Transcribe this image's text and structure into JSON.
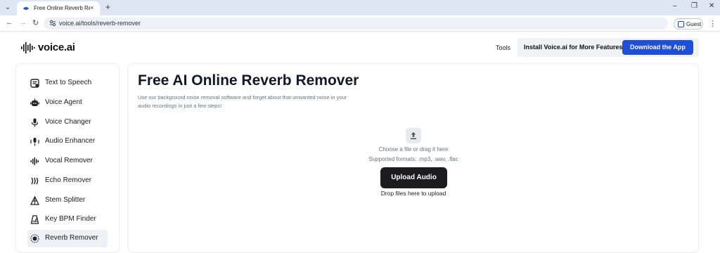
{
  "browser": {
    "tab_title": "Free Online Reverb Remover",
    "tab_close": "×",
    "new_tab": "+",
    "url": "voice.ai/tools/reverb-remover",
    "profile_label": "Guest",
    "window_controls": [
      "–",
      "❐",
      "✕"
    ],
    "nav": {
      "back": "←",
      "forward": "→",
      "reload": "↻"
    },
    "menu": "⋮"
  },
  "header": {
    "logo_text": "voice.ai",
    "tools_link": "Tools",
    "cta_text": "Install Voice.ai for More Features",
    "download_button": "Download the App"
  },
  "sidebar": {
    "items": [
      {
        "label": "Text to Speech",
        "icon": "text-to-speech-icon",
        "active": false
      },
      {
        "label": "Voice Agent",
        "icon": "voice-agent-icon",
        "active": false
      },
      {
        "label": "Voice Changer",
        "icon": "microphone-icon",
        "active": false
      },
      {
        "label": "Audio Enhancer",
        "icon": "audio-enhancer-icon",
        "active": false
      },
      {
        "label": "Vocal Remover",
        "icon": "waveform-icon",
        "active": false
      },
      {
        "label": "Echo Remover",
        "icon": "echo-icon",
        "active": false
      },
      {
        "label": "Stem Splitter",
        "icon": "stem-splitter-icon",
        "active": false
      },
      {
        "label": "Key BPM Finder",
        "icon": "metronome-icon",
        "active": false
      },
      {
        "label": "Reverb Remover",
        "icon": "reverb-icon",
        "active": true
      }
    ]
  },
  "main": {
    "title": "Free AI Online Reverb Remover",
    "description": "Use our background noise removal software and forget about that unwanted noise in your audio recordings in just a few steps!",
    "choose_text": "Choose a file or drag it here",
    "formats_text": "Supported formats: .mp3, .wav, .flac",
    "upload_button": "Upload Audio",
    "drop_text": "Drop files here to upload"
  },
  "colors": {
    "accent": "#1f4ed8",
    "dark_button": "#1c1c1f",
    "active_item_bg": "#eef0f8"
  }
}
